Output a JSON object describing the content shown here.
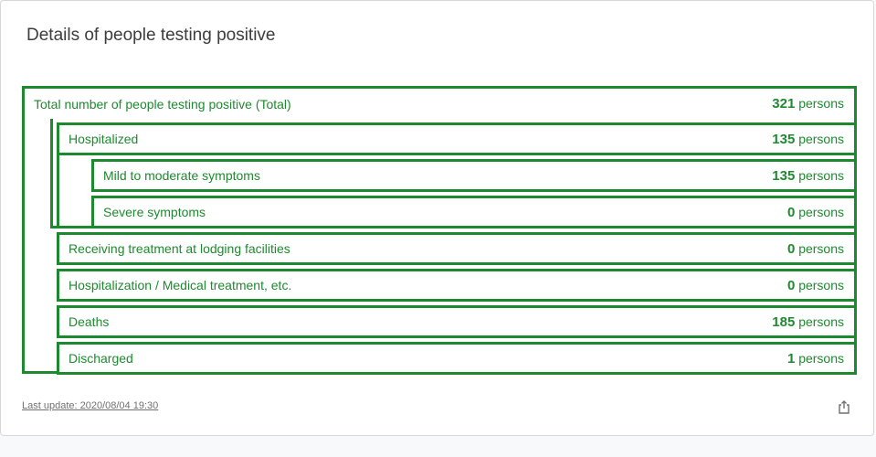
{
  "card": {
    "title": "Details of people testing positive",
    "last_update": "Last update: 2020/08/04 19:30"
  },
  "rows": [
    {
      "label": "Total number of people testing positive (Total)",
      "value": "321",
      "unit": "persons"
    },
    {
      "label": "Hospitalized",
      "value": "135",
      "unit": "persons"
    },
    {
      "label": "Mild to moderate symptoms",
      "value": "135",
      "unit": "persons"
    },
    {
      "label": "Severe symptoms",
      "value": "0",
      "unit": "persons"
    },
    {
      "label": "Receiving treatment at lodging facilities",
      "value": "0",
      "unit": "persons"
    },
    {
      "label": "Hospitalization / Medical treatment, etc.",
      "value": "0",
      "unit": "persons"
    },
    {
      "label": "Deaths",
      "value": "185",
      "unit": "persons"
    },
    {
      "label": "Discharged",
      "value": "1",
      "unit": "persons"
    }
  ],
  "colors": {
    "accent": "#1e8a2f"
  },
  "icons": {
    "share": "share-icon"
  }
}
